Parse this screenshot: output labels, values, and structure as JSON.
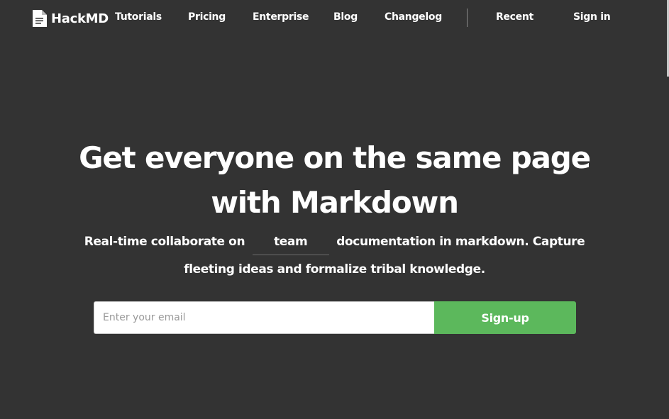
{
  "nav": {
    "brand": "HackMD",
    "links": {
      "tutorials": "Tutorials",
      "pricing": "Pricing",
      "enterprise": "Enterprise",
      "blog": "Blog",
      "changelog": "Changelog",
      "recent": "Recent",
      "signin": "Sign in"
    }
  },
  "hero": {
    "headline_line1": "Get everyone on the same page",
    "headline_line2": "with Markdown",
    "sub_prefix": "Real-time collaborate on",
    "sub_typed_word": "team",
    "sub_suffix": "documentation in markdown. Capture",
    "sub_line2": "fleeting ideas and formalize tribal knowledge."
  },
  "signup": {
    "email_placeholder": "Enter your email",
    "button_label": "Sign-up"
  },
  "colors": {
    "background": "#333333",
    "text": "#ffffff",
    "accent_green": "#5cb85c"
  }
}
